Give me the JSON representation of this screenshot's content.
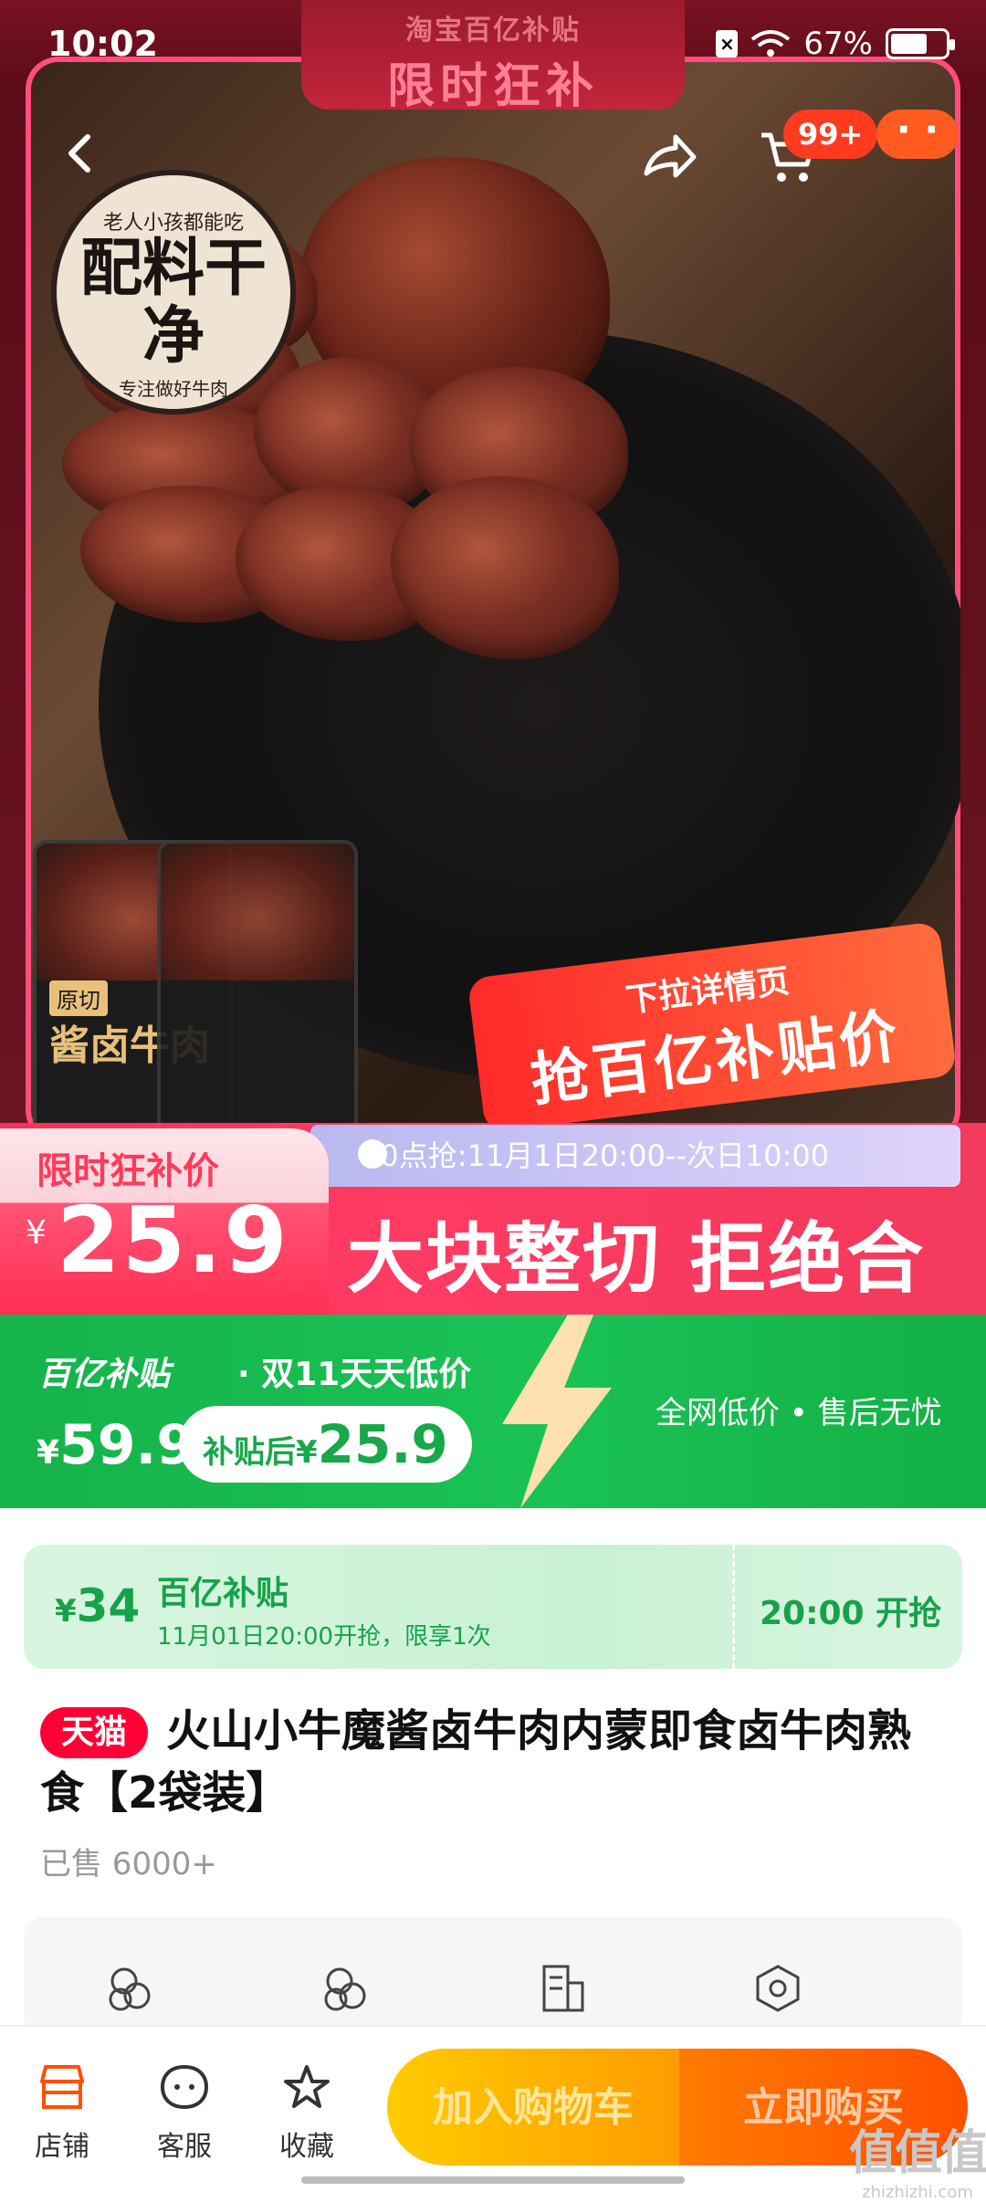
{
  "status_bar": {
    "time": "10:02",
    "battery": "67%"
  },
  "campaign": {
    "line1": "淘宝百亿补贴",
    "line2": "限时狂补"
  },
  "header": {
    "cart_badge": "99+"
  },
  "hero": {
    "stamp_top": "老人小孩都能吃",
    "stamp_main": "配料干净",
    "stamp_bottom": "专注做好牛肉",
    "package_label": "酱卤牛肉",
    "package_origin": "原切",
    "promo_line1": "下拉详情页",
    "promo_line2": "抢百亿补贴价"
  },
  "flash_sale": {
    "label": "限时狂补价",
    "currency": "¥",
    "price": "25.9",
    "time_text": "20点抢:11月1日20:00--次日10:00",
    "slogan": "大块整切 拒绝合成"
  },
  "subsidy": {
    "brand": "百亿补贴",
    "tag": "· 双11天天低价",
    "currency": "¥",
    "price": "59.9",
    "after_label": "补贴后¥",
    "after_price": "25.9",
    "right_text": "全网低价 • 售后无忧"
  },
  "coupon": {
    "currency": "¥",
    "amount": "34",
    "title": "百亿补贴",
    "subtitle": "11月01日20:00开抢，限享1次",
    "cta": "20:00 开抢"
  },
  "product": {
    "badge": "天猫",
    "title": "火山小牛魔酱卤牛肉内蒙即食卤牛肉熟食【2袋装】",
    "sold": "已售 6000+"
  },
  "bottom_nav": {
    "store": "店铺",
    "service": "客服",
    "favorite": "收藏",
    "add_to_cart": "加入购物车",
    "buy_now": "立即购买"
  },
  "watermark": {
    "main": "值值值",
    "sub": "zhizhizhi.com"
  }
}
